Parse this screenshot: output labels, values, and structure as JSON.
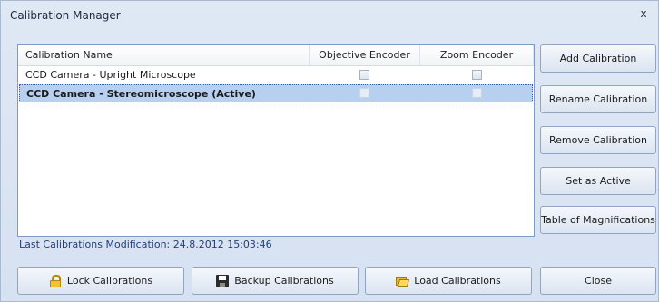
{
  "window": {
    "title": "Calibration Manager",
    "close_glyph": "x"
  },
  "table": {
    "columns": [
      "Calibration Name",
      "Objective Encoder",
      "Zoom Encoder"
    ],
    "rows": [
      {
        "name": "CCD Camera - Upright Microscope",
        "objective_encoder": false,
        "zoom_encoder": false,
        "selected": false
      },
      {
        "name": "CCD Camera - Stereomicroscope (Active)",
        "objective_encoder": false,
        "zoom_encoder": false,
        "selected": true
      }
    ]
  },
  "status": {
    "last_modification": "Last Calibrations Modification: 24.8.2012 15:03:46"
  },
  "side_buttons": {
    "add": "Add Calibration",
    "rename": "Rename Calibration",
    "remove": "Remove Calibration",
    "set_active": "Set as Active",
    "table_magnifications": "Table of Magnifications"
  },
  "bottom_buttons": {
    "lock": "Lock Calibrations",
    "backup": "Backup Calibrations",
    "load": "Load Calibrations",
    "close": "Close"
  },
  "icons": {
    "lock": "lock-icon",
    "backup": "floppy-disk-icon",
    "load": "open-folder-icon"
  },
  "colors": {
    "window_bg": "#d6e1f1",
    "selection": "#b7d0ef",
    "status_text": "#1f3f7a"
  }
}
